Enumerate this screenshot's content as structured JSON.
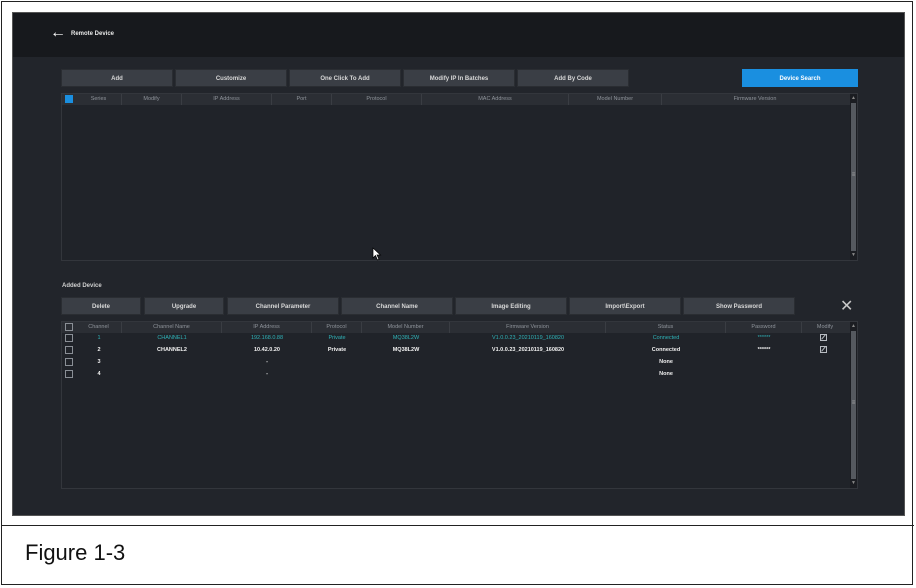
{
  "window": {
    "title": "Remote Device",
    "back_icon": "arrow-left-icon"
  },
  "toolbar": {
    "add": "Add",
    "customize": "Customize",
    "one_click_add": "One Click To Add",
    "modify_ip": "Modify IP In Batches",
    "add_by_code": "Add By Code",
    "device_search": "Device Search"
  },
  "search_table": {
    "columns": [
      "Series",
      "Modify",
      "IP Address",
      "Port",
      "Protocol",
      "MAC Address",
      "Model Number",
      "Firmware Version"
    ],
    "select_all_checked": true
  },
  "added": {
    "section_label": "Added Device",
    "buttons": {
      "delete": "Delete",
      "upgrade": "Upgrade",
      "channel_parameter": "Channel Parameter",
      "channel_name": "Channel Name",
      "image_editing": "Image Editing",
      "import_export": "Import\\Export",
      "show_password": "Show Password"
    },
    "columns": [
      "Channel",
      "Channel Name",
      "IP Address",
      "Protocol",
      "Model Number",
      "Firmware Version",
      "Status",
      "Password",
      "Modify"
    ],
    "rows": [
      {
        "channel": "1",
        "name": "CHANNEL1",
        "ip": "192.168.0.88",
        "protocol": "Private",
        "model": "MQ38L2W",
        "firmware": "V1.0.0.23_20210119_160820",
        "status": "Connected",
        "password": "******",
        "highlighted": true
      },
      {
        "channel": "2",
        "name": "CHANNEL2",
        "ip": "10.42.0.20",
        "protocol": "Private",
        "model": "MQ38L2W",
        "firmware": "V1.0.0.23_20210119_160820",
        "status": "Connected",
        "password": "******",
        "highlighted": false
      },
      {
        "channel": "3",
        "name": "",
        "ip": "-",
        "protocol": "",
        "model": "",
        "firmware": "",
        "status": "None",
        "password": "",
        "highlighted": false
      },
      {
        "channel": "4",
        "name": "",
        "ip": "-",
        "protocol": "",
        "model": "",
        "firmware": "",
        "status": "None",
        "password": "",
        "highlighted": false
      }
    ]
  },
  "caption": "Figure 1-3",
  "colors": {
    "accent": "#1a8fe0",
    "highlight_row": "#2fb3b8",
    "background": "#22252b"
  }
}
